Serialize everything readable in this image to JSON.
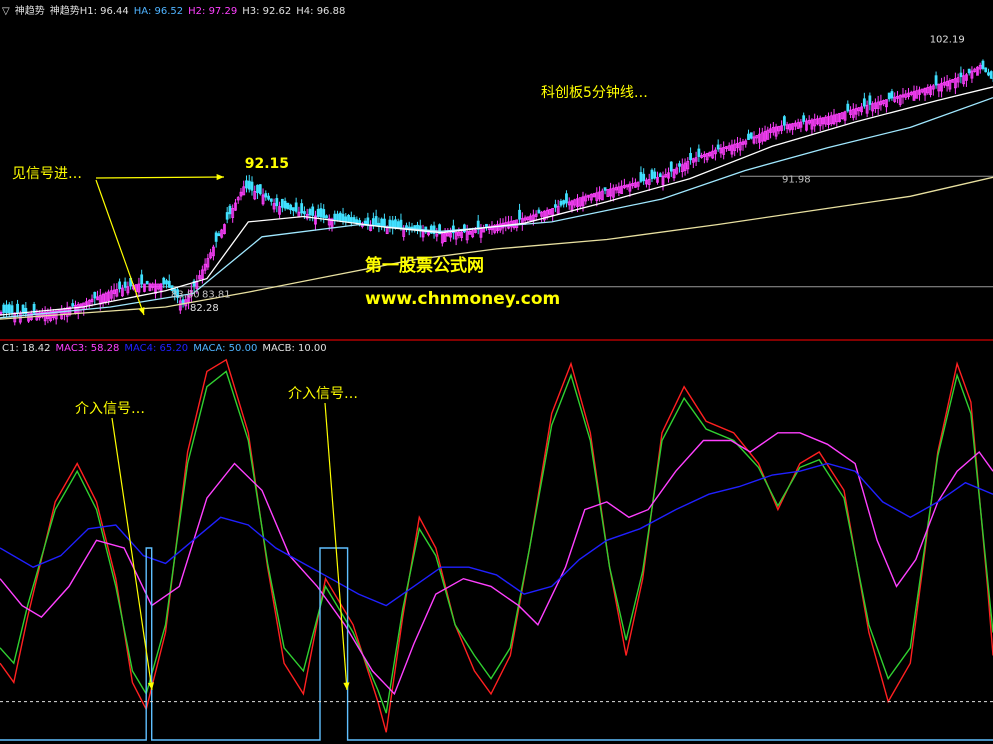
{
  "upper_legend": {
    "marker": "▽",
    "items": [
      {
        "text": "神趋势",
        "color": "#e0e0e0"
      },
      {
        "text": "神趋势H1: 96.44",
        "color": "#e0e0e0"
      },
      {
        "text": "HA: 96.52",
        "color": "#4fb3ff"
      },
      {
        "text": "H2: 97.29",
        "color": "#ff40ff"
      },
      {
        "text": "H3: 92.62",
        "color": "#e0e0e0"
      },
      {
        "text": "H4: 96.88",
        "color": "#e0e0e0"
      }
    ]
  },
  "lower_legend": {
    "items": [
      {
        "text": "C1: 18.42",
        "color": "#e0e0e0"
      },
      {
        "text": "MAC3: 58.28",
        "color": "#ff40ff"
      },
      {
        "text": "MAC4: 65.20",
        "color": "#2020ff"
      },
      {
        "text": "MACA: 50.00",
        "color": "#4fb3ff"
      },
      {
        "text": "MACB: 10.00",
        "color": "#e0e0e0"
      }
    ]
  },
  "price_labels": {
    "high": "102.19",
    "peak": "92.15",
    "low": "82.28",
    "level_a": "83.80",
    "level_b": "83.81",
    "level_c": "91.98"
  },
  "annotations": {
    "upper_signal": "见信号进…",
    "timeframe": "科创板5分钟线…",
    "entry_1": "介入信号…",
    "entry_2": "介入信号…",
    "watermark_1": "第一股票公式网",
    "watermark_2": "www.chnmoney.com"
  },
  "colors": {
    "background": "#000000",
    "up_candle": "#ff40ff",
    "down_candle": "#40e0ff",
    "ma_short": "#ffffff",
    "ma_mid": "#a0e8ff",
    "ma_long": "#e8e0a0",
    "annotation": "#ffff00",
    "divider": "#b00000",
    "osc_red": "#ff2020",
    "osc_green": "#30d030",
    "osc_magenta": "#ff40ff",
    "osc_blue": "#2020ff",
    "osc_step": "#60c0ff"
  },
  "chart_data": [
    {
      "type": "candlestick",
      "title": "神趋势",
      "price_range": [
        80,
        104
      ],
      "close_path": [
        [
          0,
          81.9
        ],
        [
          10,
          81.8
        ],
        [
          20,
          82.0
        ],
        [
          30,
          82.6
        ],
        [
          40,
          83.5
        ],
        [
          50,
          84.0
        ],
        [
          60,
          84.0
        ],
        [
          66,
          82.5
        ],
        [
          71,
          84.2
        ],
        [
          80,
          88.0
        ],
        [
          88,
          91.2
        ],
        [
          95,
          90.6
        ],
        [
          100,
          89.8
        ],
        [
          110,
          89.2
        ],
        [
          120,
          88.8
        ],
        [
          130,
          88.5
        ],
        [
          140,
          88.2
        ],
        [
          150,
          88.0
        ],
        [
          158,
          87.7
        ],
        [
          170,
          87.9
        ],
        [
          180,
          88.4
        ],
        [
          190,
          88.9
        ],
        [
          200,
          89.6
        ],
        [
          210,
          90.4
        ],
        [
          220,
          91.0
        ],
        [
          230,
          91.5
        ],
        [
          240,
          92.0
        ],
        [
          250,
          93.2
        ],
        [
          260,
          94.0
        ],
        [
          270,
          94.6
        ],
        [
          280,
          95.6
        ],
        [
          290,
          96.0
        ],
        [
          300,
          96.4
        ],
        [
          310,
          97.0
        ],
        [
          320,
          97.6
        ],
        [
          330,
          98.2
        ],
        [
          340,
          98.8
        ],
        [
          350,
          99.5
        ],
        [
          355,
          100.2
        ],
        [
          360,
          99.0
        ]
      ],
      "ma_levels": {
        "short": [
          [
            0,
            81.7
          ],
          [
            30,
            82.3
          ],
          [
            60,
            83.5
          ],
          [
            75,
            84.4
          ],
          [
            90,
            88.6
          ],
          [
            110,
            89.0
          ],
          [
            140,
            88.2
          ],
          [
            160,
            87.8
          ],
          [
            190,
            88.5
          ],
          [
            220,
            90.1
          ],
          [
            250,
            91.8
          ],
          [
            280,
            94.2
          ],
          [
            310,
            96.0
          ],
          [
            340,
            97.6
          ],
          [
            360,
            98.6
          ]
        ],
        "mid": [
          [
            0,
            81.5
          ],
          [
            40,
            82.3
          ],
          [
            70,
            83.3
          ],
          [
            95,
            87.5
          ],
          [
            130,
            88.4
          ],
          [
            160,
            87.9
          ],
          [
            200,
            88.6
          ],
          [
            240,
            90.3
          ],
          [
            270,
            92.4
          ],
          [
            300,
            94.1
          ],
          [
            330,
            95.6
          ],
          [
            360,
            97.8
          ]
        ],
        "long": [
          [
            0,
            81.4
          ],
          [
            60,
            82.3
          ],
          [
            90,
            83.4
          ],
          [
            120,
            84.6
          ],
          [
            150,
            85.8
          ],
          [
            180,
            86.6
          ],
          [
            220,
            87.3
          ],
          [
            260,
            88.4
          ],
          [
            300,
            89.6
          ],
          [
            330,
            90.5
          ],
          [
            360,
            91.9
          ]
        ]
      },
      "reference_lines": [
        83.8,
        91.98
      ],
      "marked_points": {
        "low": [
          66,
          82.28
        ],
        "peak": [
          88,
          92.15
        ],
        "high": [
          353,
          102.19
        ]
      }
    },
    {
      "type": "line",
      "title": "",
      "y_range": [
        0,
        100
      ],
      "series": [
        {
          "name": "C1",
          "color": "#ff2020",
          "values": [
            [
              0,
              20
            ],
            [
              5,
              15
            ],
            [
              10,
              32
            ],
            [
              20,
              62
            ],
            [
              28,
              72
            ],
            [
              35,
              62
            ],
            [
              42,
              42
            ],
            [
              48,
              15
            ],
            [
              53,
              8
            ],
            [
              60,
              28
            ],
            [
              68,
              75
            ],
            [
              75,
              96
            ],
            [
              82,
              99
            ],
            [
              90,
              80
            ],
            [
              97,
              45
            ],
            [
              103,
              20
            ],
            [
              110,
              12
            ],
            [
              118,
              42
            ],
            [
              128,
              30
            ],
            [
              137,
              10
            ],
            [
              140,
              2
            ],
            [
              146,
              32
            ],
            [
              152,
              58
            ],
            [
              158,
              50
            ],
            [
              165,
              30
            ],
            [
              172,
              18
            ],
            [
              178,
              12
            ],
            [
              185,
              22
            ],
            [
              192,
              50
            ],
            [
              200,
              85
            ],
            [
              207,
              98
            ],
            [
              214,
              80
            ],
            [
              221,
              45
            ],
            [
              227,
              22
            ],
            [
              233,
              42
            ],
            [
              240,
              80
            ],
            [
              248,
              92
            ],
            [
              256,
              83
            ],
            [
              266,
              80
            ],
            [
              275,
              72
            ],
            [
              282,
              60
            ],
            [
              290,
              72
            ],
            [
              297,
              75
            ],
            [
              306,
              65
            ],
            [
              315,
              28
            ],
            [
              322,
              10
            ],
            [
              330,
              20
            ],
            [
              340,
              75
            ],
            [
              347,
              98
            ],
            [
              352,
              88
            ],
            [
              358,
              40
            ],
            [
              360,
              22
            ]
          ]
        },
        {
          "name": "",
          "color": "#30d030",
          "values": [
            [
              0,
              24
            ],
            [
              5,
              20
            ],
            [
              10,
              35
            ],
            [
              20,
              60
            ],
            [
              28,
              70
            ],
            [
              35,
              60
            ],
            [
              42,
              40
            ],
            [
              48,
              18
            ],
            [
              53,
              12
            ],
            [
              60,
              30
            ],
            [
              68,
              72
            ],
            [
              75,
              92
            ],
            [
              82,
              96
            ],
            [
              90,
              78
            ],
            [
              97,
              46
            ],
            [
              103,
              24
            ],
            [
              110,
              18
            ],
            [
              118,
              40
            ],
            [
              128,
              28
            ],
            [
              137,
              13
            ],
            [
              140,
              7
            ],
            [
              146,
              34
            ],
            [
              152,
              55
            ],
            [
              158,
              48
            ],
            [
              165,
              30
            ],
            [
              172,
              22
            ],
            [
              178,
              16
            ],
            [
              185,
              24
            ],
            [
              192,
              50
            ],
            [
              200,
              82
            ],
            [
              207,
              95
            ],
            [
              214,
              78
            ],
            [
              221,
              45
            ],
            [
              227,
              26
            ],
            [
              233,
              44
            ],
            [
              240,
              78
            ],
            [
              248,
              89
            ],
            [
              256,
              81
            ],
            [
              266,
              78
            ],
            [
              275,
              71
            ],
            [
              282,
              61
            ],
            [
              290,
              71
            ],
            [
              297,
              73
            ],
            [
              306,
              63
            ],
            [
              315,
              30
            ],
            [
              322,
              16
            ],
            [
              330,
              24
            ],
            [
              340,
              74
            ],
            [
              347,
              95
            ],
            [
              352,
              85
            ],
            [
              358,
              42
            ],
            [
              360,
              28
            ]
          ]
        },
        {
          "name": "MAC3",
          "color": "#ff40ff",
          "values": [
            [
              0,
              42
            ],
            [
              8,
              35
            ],
            [
              15,
              32
            ],
            [
              25,
              40
            ],
            [
              35,
              52
            ],
            [
              45,
              50
            ],
            [
              55,
              35
            ],
            [
              65,
              40
            ],
            [
              75,
              63
            ],
            [
              85,
              72
            ],
            [
              95,
              65
            ],
            [
              105,
              48
            ],
            [
              115,
              40
            ],
            [
              125,
              30
            ],
            [
              135,
              18
            ],
            [
              143,
              12
            ],
            [
              150,
              25
            ],
            [
              158,
              38
            ],
            [
              168,
              42
            ],
            [
              178,
              40
            ],
            [
              188,
              35
            ],
            [
              195,
              30
            ],
            [
              205,
              45
            ],
            [
              212,
              60
            ],
            [
              220,
              62
            ],
            [
              228,
              58
            ],
            [
              235,
              60
            ],
            [
              245,
              70
            ],
            [
              255,
              78
            ],
            [
              265,
              78
            ],
            [
              272,
              75
            ],
            [
              282,
              80
            ],
            [
              290,
              80
            ],
            [
              300,
              77
            ],
            [
              310,
              72
            ],
            [
              318,
              52
            ],
            [
              325,
              40
            ],
            [
              332,
              47
            ],
            [
              340,
              62
            ],
            [
              347,
              70
            ],
            [
              355,
              75
            ],
            [
              360,
              70
            ]
          ]
        },
        {
          "name": "MAC4",
          "color": "#2020ff",
          "values": [
            [
              0,
              50
            ],
            [
              12,
              45
            ],
            [
              22,
              48
            ],
            [
              32,
              55
            ],
            [
              42,
              56
            ],
            [
              52,
              48
            ],
            [
              60,
              46
            ],
            [
              70,
              52
            ],
            [
              80,
              58
            ],
            [
              90,
              56
            ],
            [
              100,
              50
            ],
            [
              110,
              46
            ],
            [
              120,
              42
            ],
            [
              130,
              38
            ],
            [
              140,
              35
            ],
            [
              150,
              40
            ],
            [
              160,
              45
            ],
            [
              170,
              45
            ],
            [
              180,
              43
            ],
            [
              190,
              38
            ],
            [
              200,
              40
            ],
            [
              210,
              47
            ],
            [
              220,
              52
            ],
            [
              232,
              55
            ],
            [
              245,
              60
            ],
            [
              257,
              64
            ],
            [
              268,
              66
            ],
            [
              280,
              69
            ],
            [
              290,
              70
            ],
            [
              300,
              72
            ],
            [
              310,
              70
            ],
            [
              320,
              62
            ],
            [
              330,
              58
            ],
            [
              340,
              62
            ],
            [
              350,
              67
            ],
            [
              360,
              64
            ]
          ]
        },
        {
          "name": "MACA",
          "color": "#60c0ff",
          "step": true,
          "values": [
            [
              0,
              0
            ],
            [
              53,
              0
            ],
            [
              53,
              50
            ],
            [
              55,
              50
            ],
            [
              55,
              0
            ],
            [
              116,
              0
            ],
            [
              116,
              50
            ],
            [
              126,
              50
            ],
            [
              126,
              0
            ],
            [
              360,
              0
            ]
          ]
        },
        {
          "name": "MACB",
          "color": "#e0e0e0",
          "dashed": true,
          "values": [
            [
              0,
              10
            ],
            [
              360,
              10
            ]
          ]
        }
      ]
    }
  ]
}
